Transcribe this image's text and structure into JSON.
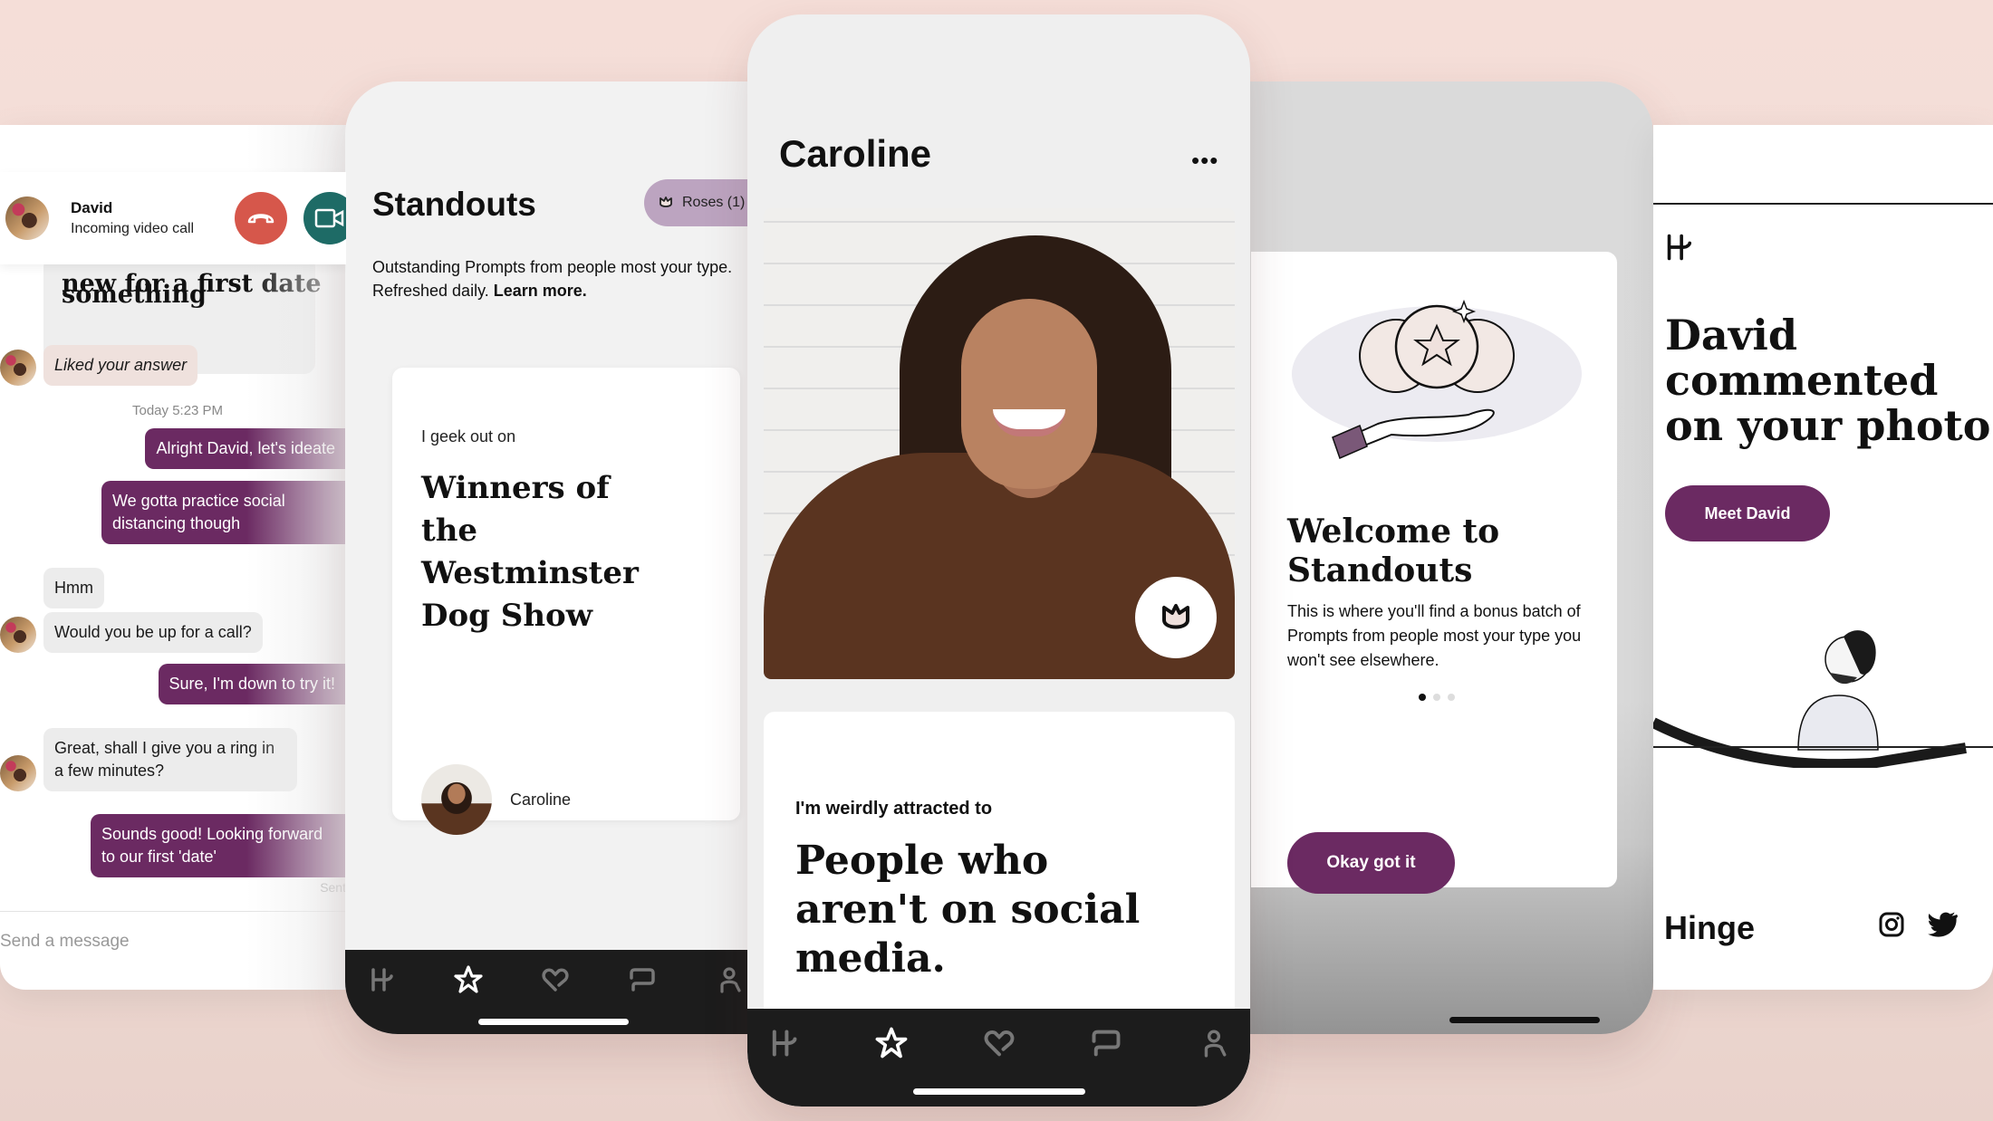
{
  "colors": {
    "background": "#f4dfd9",
    "brand_purple": "#6b2a62",
    "decline_red": "#d6574b",
    "video_teal": "#1e6b66",
    "roses_pill": "#bca4c0",
    "nav_dark": "#1c1c1c"
  },
  "chat": {
    "call": {
      "name": "David",
      "status": "Incoming video call",
      "decline_icon": "phone-hangup-icon",
      "accept_icon": "video-camera-icon"
    },
    "prompt_partial_line": "Both do something",
    "prompt_text": "new for a first date",
    "liked_label": "Liked your answer",
    "timestamp": "Today 5:23 PM",
    "messages": [
      {
        "from": "me",
        "text": "Alright David, let's ideate"
      },
      {
        "from": "me",
        "text": "We gotta practice social distancing though"
      },
      {
        "from": "david",
        "text": "Hmm"
      },
      {
        "from": "david",
        "text": "Would you be up for a call?"
      },
      {
        "from": "me",
        "text": "Sure, I'm down to try it!"
      },
      {
        "from": "david",
        "text": "Great, shall I give you a ring in a few minutes?"
      },
      {
        "from": "me",
        "text": "Sounds good! Looking forward to our first 'date'"
      }
    ],
    "sent_label": "Sent",
    "composer_placeholder": "Send a message"
  },
  "standouts": {
    "title": "Standouts",
    "roses_label": "Roses (1)",
    "description": "Outstanding Prompts from people most your type. Refreshed daily.",
    "learn_more": "Learn more.",
    "card": {
      "prompt": "I geek out on",
      "answer": "Winners of the Westminster Dog Show",
      "person_name": "Caroline"
    },
    "nav": [
      "hinge-home-icon",
      "star-icon",
      "heart-icon",
      "chat-icon",
      "profile-icon"
    ],
    "active_nav": 1
  },
  "profile": {
    "name": "Caroline",
    "more_label": "•••",
    "photo_alt": "Smiling woman in brown sweater against white brick wall",
    "rose_button_icon": "rose-icon",
    "prompt": "I'm weirdly attracted to",
    "answer": "People who aren't on social media.",
    "active_nav": 1
  },
  "welcome": {
    "title": "Welcome to Standouts",
    "body": "This is where you'll find a bonus batch of Prompts from people most your type you won't see elsewhere.",
    "pagination": {
      "current": 1,
      "total": 3
    },
    "button_label": "Okay got it"
  },
  "notification": {
    "headline": "David commented on your photo",
    "button_label": "Meet David",
    "brand": "Hinge",
    "social": [
      "instagram-icon",
      "twitter-icon"
    ]
  }
}
